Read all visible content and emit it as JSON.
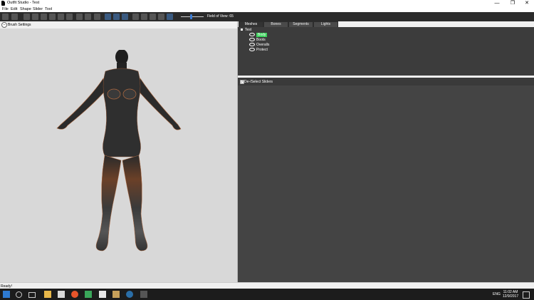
{
  "window": {
    "title": "Outfit Studio - Test",
    "controls": {
      "minimize": "—",
      "maximize": "❐",
      "close": "✕"
    }
  },
  "menu": [
    "File",
    "Edit",
    "Shape",
    "Slider",
    "Tool"
  ],
  "toolbar": {
    "fov_label": "Field of View: 65",
    "fov_value": 65
  },
  "brush": {
    "toggle": "–",
    "label": "Brush Settings"
  },
  "tabs": [
    {
      "label": "Meshes",
      "active": true
    },
    {
      "label": "Bones",
      "active": false
    },
    {
      "label": "Segments",
      "active": false
    },
    {
      "label": "Lights",
      "active": false
    }
  ],
  "tree": {
    "root": "Test",
    "items": [
      {
        "label": "Body",
        "selected": true
      },
      {
        "label": "Boots",
        "selected": false
      },
      {
        "label": "Overalls",
        "selected": false
      },
      {
        "label": "Protect",
        "selected": false
      }
    ]
  },
  "sliders": {
    "label": "De-/Select Sliders",
    "check": "✓"
  },
  "status": {
    "text": "Ready!"
  },
  "taskbar": {
    "ime": "ENG",
    "time": "11:02 AM",
    "date": "12/9/2017"
  },
  "colors": {
    "viewport_bg": "#d8d8d8",
    "panel_dark": "#3c3c3c",
    "selected": "#3ad05a",
    "accent": "#3a7bd5"
  }
}
